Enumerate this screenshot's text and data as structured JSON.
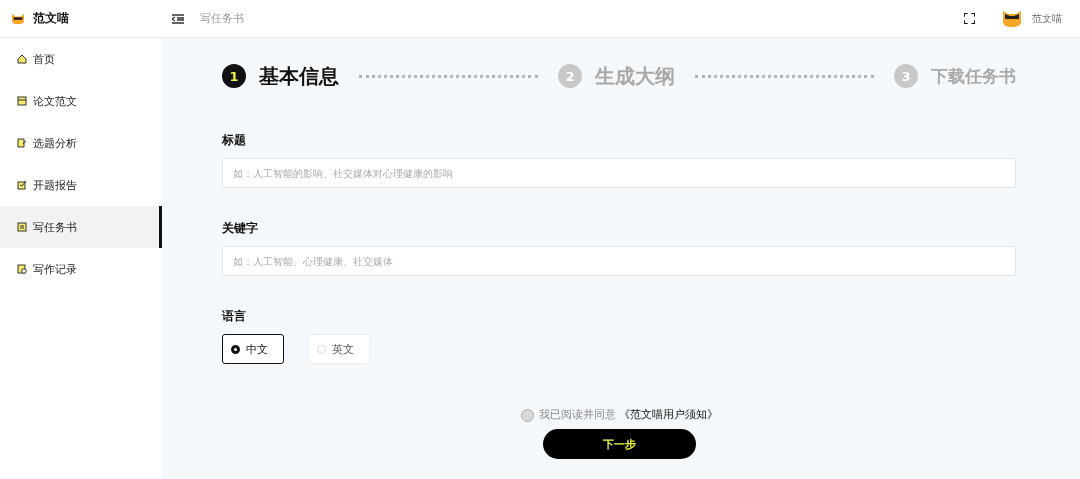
{
  "app": {
    "name": "范文喵"
  },
  "topbar": {
    "breadcrumb": "写任务书",
    "user": "范文喵"
  },
  "sidebar": {
    "items": [
      {
        "label": "首页",
        "kind": "home",
        "selected": false
      },
      {
        "label": "论文范文",
        "kind": "doc",
        "selected": false
      },
      {
        "label": "选题分析",
        "kind": "edit",
        "selected": false
      },
      {
        "label": "开题报告",
        "kind": "check",
        "selected": false
      },
      {
        "label": "写任务书",
        "kind": "list",
        "selected": true
      },
      {
        "label": "写作记录",
        "kind": "record",
        "selected": false
      }
    ]
  },
  "steps": [
    {
      "number": "1",
      "label": "基本信息",
      "selected": true
    },
    {
      "number": "2",
      "label": "生成大纲",
      "selected": false
    },
    {
      "number": "3",
      "label": "下载任务书",
      "selected": false
    }
  ],
  "form": {
    "fields": [
      {
        "label": "标题",
        "placeholder": "如：人工智能的影响、社交媒体对心理健康的影响"
      },
      {
        "label": "关键字",
        "placeholder": "如：人工智能、心理健康、社交媒体"
      }
    ],
    "language": {
      "label": "语言",
      "options": [
        {
          "label": "中文",
          "selected": true
        },
        {
          "label": "英文",
          "selected": false
        }
      ]
    },
    "agreement": {
      "text": "我已阅读并同意",
      "link": "《范文喵用户须知》",
      "checked": false
    },
    "next_button": "下一步"
  }
}
